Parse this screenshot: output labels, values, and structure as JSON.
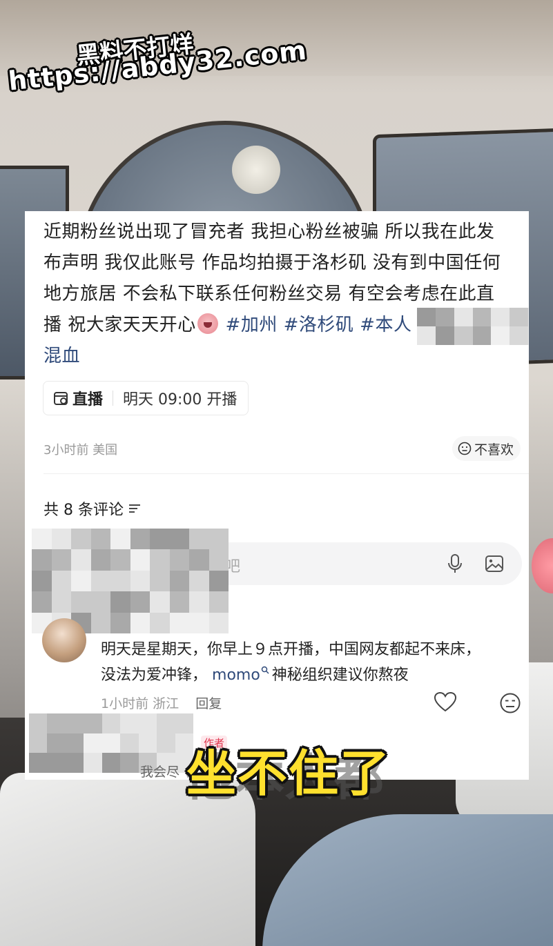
{
  "watermark": {
    "line1": "黑料不打烊",
    "line2": "https://abdy32.com"
  },
  "post": {
    "text_lines": [
      "近期粉丝说出现了冒充者 我担心粉丝被骗 所以我在此发",
      "布声明 我仅此账号 作品均拍摄于洛杉矶 没有到中国任何",
      "地方旅居 不会私下联系任何粉丝交易 有空会考虑在此直",
      "播 祝大家天天开心"
    ],
    "hashtags": [
      "#加州",
      "#洛杉矶",
      "#本人"
    ],
    "last_line": "混血",
    "emoji": "pig-face-emoji"
  },
  "live": {
    "icon": "calendar-live-icon",
    "label": "直播",
    "schedule": "明天 09:00 开播"
  },
  "meta": {
    "time_location": "3小时前 美国",
    "dislike_label": "不喜欢",
    "dislike_icon": "neutral-face-icon"
  },
  "comments": {
    "count_label": "共 8 条评论",
    "sort_icon": "sort-lines-icon",
    "input_placeholder": "吧",
    "mic_icon": "microphone-icon",
    "image_icon": "image-icon",
    "items": [
      {
        "text_part1": "明天是星期天，你早上９点开播，中国网友都起不来床，",
        "text_part2": "没法为爱冲锋，",
        "mention": "momo",
        "text_part3": "神秘组织建议你熬夜",
        "time_location": "1小时前 浙江",
        "reply_label": "回复",
        "like_icon": "heart-icon",
        "react_icon": "neutral-face-icon"
      }
    ],
    "author_badge": "作者",
    "reply_preview": "我会尽"
  },
  "caption": {
    "text": "坐不住了",
    "underlying_text": "他本人都",
    "color": "#ffe02e"
  },
  "colors": {
    "link_blue": "#2f4a7a",
    "text_dark": "#222222",
    "meta_gray": "#999999"
  }
}
